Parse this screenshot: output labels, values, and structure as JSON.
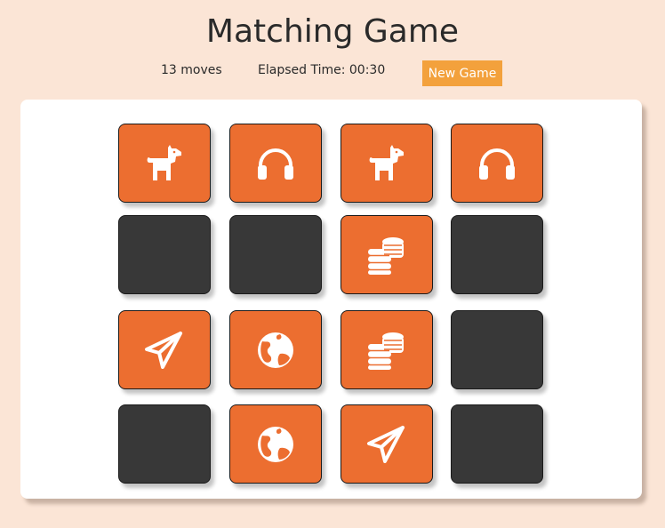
{
  "game": {
    "title": "Matching Game",
    "moves": "13 moves",
    "elapsed": "Elapsed Time: 00:30",
    "new_game_label": "New Game"
  },
  "colors": {
    "background": "#fbe5d6",
    "card_open": "#ec6e30",
    "card_closed": "#383838",
    "button": "#f3a13c"
  },
  "cards": [
    {
      "row": 1,
      "col": 1,
      "state": "open",
      "icon": "dog-icon"
    },
    {
      "row": 1,
      "col": 2,
      "state": "open",
      "icon": "headphones-icon"
    },
    {
      "row": 1,
      "col": 3,
      "state": "open",
      "icon": "dog-icon"
    },
    {
      "row": 1,
      "col": 4,
      "state": "open",
      "icon": "headphones-icon"
    },
    {
      "row": 2,
      "col": 1,
      "state": "closed",
      "icon": null
    },
    {
      "row": 2,
      "col": 2,
      "state": "closed",
      "icon": null
    },
    {
      "row": 2,
      "col": 3,
      "state": "open",
      "icon": "coins-icon"
    },
    {
      "row": 2,
      "col": 4,
      "state": "closed",
      "icon": null
    },
    {
      "row": 3,
      "col": 1,
      "state": "open",
      "icon": "paper-plane-icon"
    },
    {
      "row": 3,
      "col": 2,
      "state": "open",
      "icon": "globe-icon"
    },
    {
      "row": 3,
      "col": 3,
      "state": "open",
      "icon": "coins-icon"
    },
    {
      "row": 3,
      "col": 4,
      "state": "closed",
      "icon": null
    },
    {
      "row": 4,
      "col": 1,
      "state": "closed",
      "icon": null
    },
    {
      "row": 4,
      "col": 2,
      "state": "open",
      "icon": "globe-icon"
    },
    {
      "row": 4,
      "col": 3,
      "state": "open",
      "icon": "paper-plane-icon"
    },
    {
      "row": 4,
      "col": 4,
      "state": "closed",
      "icon": null
    }
  ]
}
